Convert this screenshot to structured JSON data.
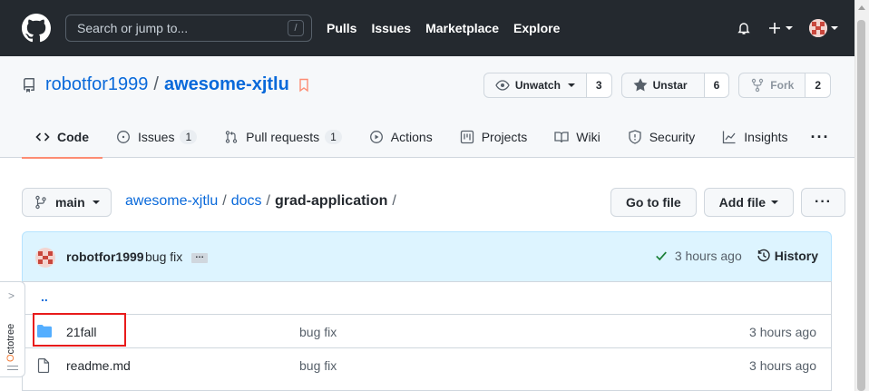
{
  "header": {
    "search_placeholder": "Search or jump to...",
    "search_shortcut": "/",
    "nav": [
      "Pulls",
      "Issues",
      "Marketplace",
      "Explore"
    ]
  },
  "repo": {
    "owner": "robotfor1999",
    "name": "awesome-xjtlu",
    "watch_label": "Unwatch",
    "watch_count": "3",
    "star_label": "Unstar",
    "star_count": "6",
    "fork_label": "Fork",
    "fork_count": "2"
  },
  "tabs": [
    {
      "label": "Code",
      "icon": "code-icon"
    },
    {
      "label": "Issues",
      "icon": "issue-icon",
      "count": "1"
    },
    {
      "label": "Pull requests",
      "icon": "pull-request-icon",
      "count": "1"
    },
    {
      "label": "Actions",
      "icon": "play-icon"
    },
    {
      "label": "Projects",
      "icon": "project-icon"
    },
    {
      "label": "Wiki",
      "icon": "book-icon"
    },
    {
      "label": "Security",
      "icon": "shield-icon"
    },
    {
      "label": "Insights",
      "icon": "graph-icon"
    }
  ],
  "filenav": {
    "branch": "main",
    "path": [
      "awesome-xjtlu",
      "docs",
      "grad-application"
    ],
    "go_to_file": "Go to file",
    "add_file": "Add file"
  },
  "commit": {
    "author": "robotfor1999",
    "message": "bug fix",
    "ellipsis": "…",
    "age": "3 hours ago",
    "history": "History"
  },
  "files": {
    "parent": "..",
    "rows": [
      {
        "name": "21fall",
        "type": "folder",
        "message": "bug fix",
        "age": "3 hours ago"
      },
      {
        "name": "readme.md",
        "type": "file",
        "message": "bug fix",
        "age": "3 hours ago"
      }
    ]
  },
  "octotree": {
    "label_accent": "O",
    "label_rest": "ctotree"
  },
  "colors": {
    "accent": "#0969da",
    "header": "#24292f",
    "active_tab": "#fd8c73",
    "highlight": "#e81b1b",
    "folder": "#54aeff"
  }
}
